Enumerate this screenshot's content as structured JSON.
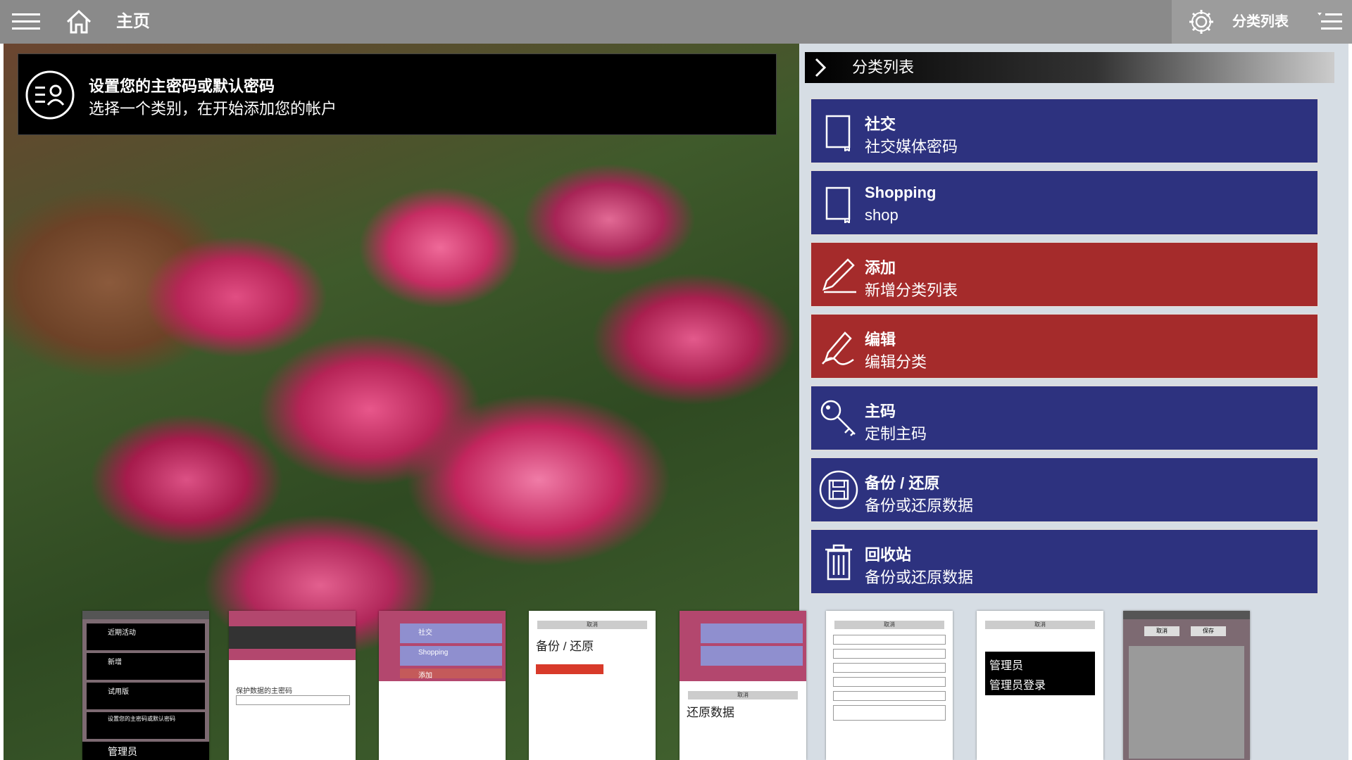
{
  "topbar": {
    "title": "主页",
    "right_label": "分类列表",
    "icons": [
      "hamburger-icon",
      "home-icon",
      "gear-icon",
      "list-icon"
    ]
  },
  "banner": {
    "title": "设置您的主密码或默认密码",
    "subtitle": "选择一个类别，在开始添加您的帐户"
  },
  "panel": {
    "header": "分类列表",
    "tiles": [
      {
        "title": "社交",
        "subtitle": "社交媒体密码",
        "color": "blue",
        "icon": "notebook-icon"
      },
      {
        "title": "Shopping",
        "subtitle": "shop",
        "color": "blue",
        "icon": "notebook-icon"
      },
      {
        "title": "添加",
        "subtitle": "新增分类列表",
        "color": "red",
        "icon": "pen-icon"
      },
      {
        "title": "编辑",
        "subtitle": "编辑分类",
        "color": "red",
        "icon": "edit-icon"
      },
      {
        "title": "主码",
        "subtitle": "定制主码",
        "color": "blue",
        "icon": "key-icon"
      },
      {
        "title": "备份 / 还原",
        "subtitle": "备份或还原数据",
        "color": "blue",
        "icon": "save-icon"
      },
      {
        "title": "回收站",
        "subtitle": "备份或还原数据",
        "color": "blue",
        "icon": "trash-icon"
      }
    ]
  },
  "thumbnails": {
    "t1": {
      "items": [
        "近期活动",
        "新增",
        "试用版",
        "设置您的主密码或默认密码",
        "管理员"
      ]
    },
    "t2": {
      "title": "保护数据的主密码"
    },
    "t3": {
      "items": [
        "社交",
        "Shopping",
        "添加"
      ]
    },
    "t4": {
      "cancel": "取消",
      "title": "备份 / 还原"
    },
    "t5": {
      "cancel": "取消",
      "title": "还原数据"
    },
    "t6": {
      "cancel": "取消"
    },
    "t7": {
      "cancel": "取消",
      "title1": "管理员",
      "title2": "管理员登录"
    },
    "t8": {
      "cancel": "取消",
      "save": "保存"
    }
  },
  "colors": {
    "tile_blue": "#2d327f",
    "tile_red": "#a52b2b",
    "panel_bg": "#d6dde4",
    "topbar_bg": "#8a8a8a"
  }
}
